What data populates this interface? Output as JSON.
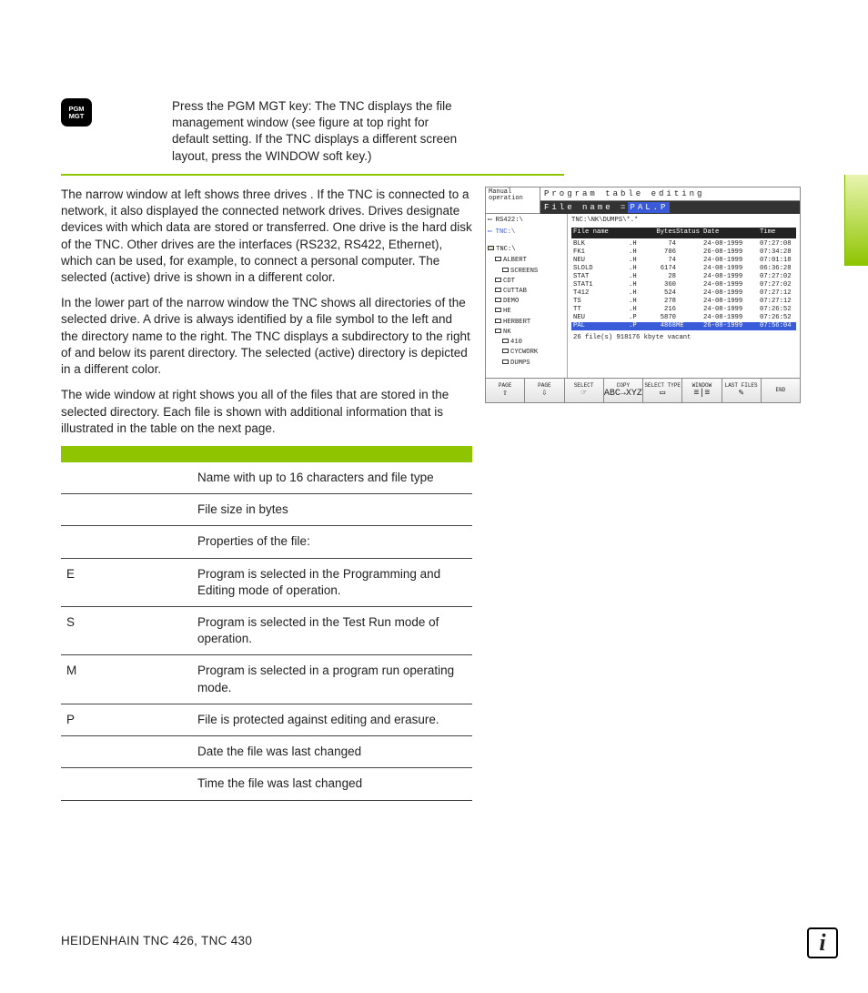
{
  "key_label": "PGM MGT",
  "para_pgmmgt": "Press the PGM MGT key: The TNC displays the file management window (see figure at top right for default setting. If the TNC displays a different screen layout, press the WINDOW soft key.)",
  "para_drives": "The narrow window at left shows three drives     . If the TNC is connected to a network, it also displayed the connected network drives. Drives designate devices with which data are stored or transferred. One drive is the hard disk of the TNC. Other drives are the interfaces (RS232, RS422, Ethernet), which can be used, for example, to connect a personal computer. The selected (active) drive is shown in a different color.",
  "para_dirs": "In the lower part of the narrow window the TNC shows all directories        of the selected drive. A drive is always identified by a file symbol to the left and the directory name to the right. The TNC displays a subdirectory to the right of and below its parent directory. The selected (active) directory is depicted in a different color.",
  "para_files": "The wide window at right    shows you all of the files that are stored in the selected directory. Each file is shown with additional information that is illustrated in the table on the next page.",
  "table_rows": [
    {
      "k": "",
      "v": "Name with up to 16 characters and file type"
    },
    {
      "k": "",
      "v": "File size in bytes"
    },
    {
      "k": "",
      "v": "Properties of the file:"
    },
    {
      "k": "E",
      "v": "Program is selected in the Programming and Editing mode of operation."
    },
    {
      "k": "S",
      "v": "Program is selected in the Test Run mode of operation."
    },
    {
      "k": "M",
      "v": "Program is selected in a program run operating mode."
    },
    {
      "k": "P",
      "v": "File is protected against editing and erasure."
    },
    {
      "k": "",
      "v": "Date the file was last changed"
    },
    {
      "k": "",
      "v": "Time the file was last changed"
    }
  ],
  "footer": "HEIDENHAIN TNC 426, TNC 430",
  "screenshot": {
    "mode": "Manual operation",
    "title": "Program table editing",
    "file_label": "File name =",
    "file_value": "PAL.P",
    "drives": [
      "RS422:\\",
      "TNC:\\"
    ],
    "active_drive_idx": 1,
    "tree_label": "TNC:\\",
    "dirs": [
      "ALBERT",
      "SCREENS",
      "CDT",
      "CUTTAB",
      "DEMO",
      "HE",
      "HERBERT",
      "NK",
      "410",
      "CYCWORK",
      "DUMPS"
    ],
    "path": "TNC:\\NK\\DUMPS\\*.*",
    "cols": [
      "File name",
      "",
      "Bytes",
      "Status",
      "Date",
      "Time"
    ],
    "files": [
      {
        "n": "BLK",
        "e": ".H",
        "b": "74",
        "s": "",
        "d": "24-08-1999",
        "t": "07:27:08"
      },
      {
        "n": "FK1",
        "e": ".H",
        "b": "706",
        "s": "",
        "d": "26-08-1999",
        "t": "07:34:28"
      },
      {
        "n": "NEU",
        "e": ".H",
        "b": "74",
        "s": "",
        "d": "24-08-1999",
        "t": "07:01:18"
      },
      {
        "n": "SLOLD",
        "e": ".H",
        "b": "6174",
        "s": "",
        "d": "24-08-1999",
        "t": "06:36:28"
      },
      {
        "n": "STAT",
        "e": ".H",
        "b": "28",
        "s": "",
        "d": "24-08-1999",
        "t": "07:27:02"
      },
      {
        "n": "STAT1",
        "e": ".H",
        "b": "360",
        "s": "",
        "d": "24-08-1999",
        "t": "07:27:02"
      },
      {
        "n": "T412",
        "e": ".H",
        "b": "524",
        "s": "",
        "d": "24-08-1999",
        "t": "07:27:12"
      },
      {
        "n": "TS",
        "e": ".H",
        "b": "278",
        "s": "",
        "d": "24-08-1999",
        "t": "07:27:12"
      },
      {
        "n": "TT",
        "e": ".H",
        "b": "216",
        "s": "",
        "d": "24-08-1999",
        "t": "07:26:52"
      },
      {
        "n": "NEU",
        "e": ".P",
        "b": "5870",
        "s": "",
        "d": "24-08-1999",
        "t": "07:26:52"
      },
      {
        "n": "PAL",
        "e": ".P",
        "b": "4868",
        "s": "ME",
        "d": "26-08-1999",
        "t": "07:56:04",
        "sel": true
      }
    ],
    "status": "26  file(s) 918176 kbyte vacant",
    "softkeys": [
      {
        "l": "PAGE",
        "i": "⇧"
      },
      {
        "l": "PAGE",
        "i": "⇩"
      },
      {
        "l": "SELECT",
        "i": "☞"
      },
      {
        "l": "COPY",
        "i": "ABC→XYZ"
      },
      {
        "l": "SELECT TYPE",
        "i": "▭"
      },
      {
        "l": "WINDOW",
        "i": "≡|≡"
      },
      {
        "l": "LAST FILES",
        "i": "✎"
      },
      {
        "l": "END",
        "i": ""
      }
    ]
  }
}
